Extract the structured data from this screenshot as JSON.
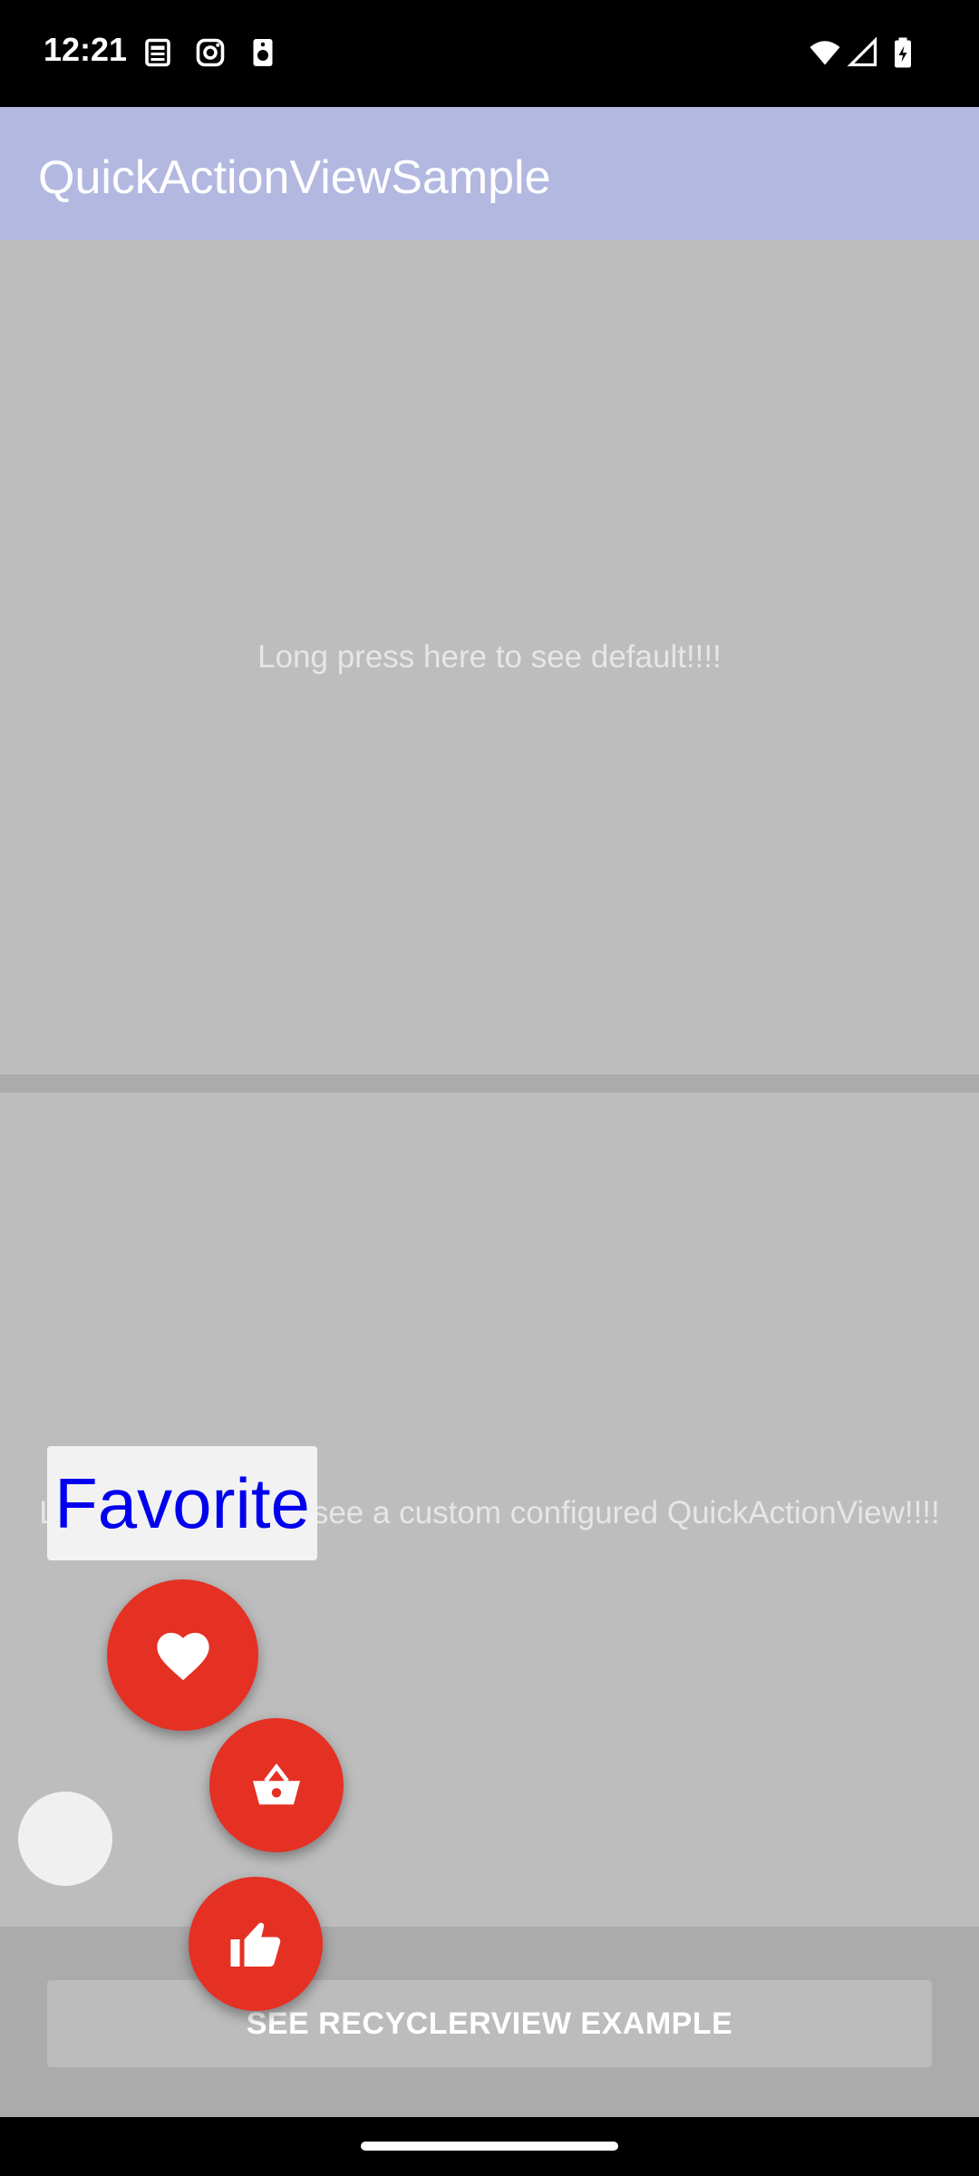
{
  "status_bar": {
    "time": "12:21",
    "icons": [
      "news-icon",
      "instagram-icon",
      "speaker-icon",
      "wifi-icon",
      "signal-icon",
      "battery-icon"
    ]
  },
  "app_bar": {
    "title": "QuickActionViewSample"
  },
  "panel_default": {
    "text": "Long press here to see default!!!!"
  },
  "panel_custom": {
    "text": "Long press here to see a custom configured QuickActionView!!!!"
  },
  "quick_action": {
    "tooltip": "Favorite",
    "actions": [
      "heart-icon",
      "basket-icon",
      "thumbs-up-icon"
    ],
    "accent": "#e53024"
  },
  "recycler_button": {
    "label": "SEE RECYCLERVIEW EXAMPLE"
  }
}
